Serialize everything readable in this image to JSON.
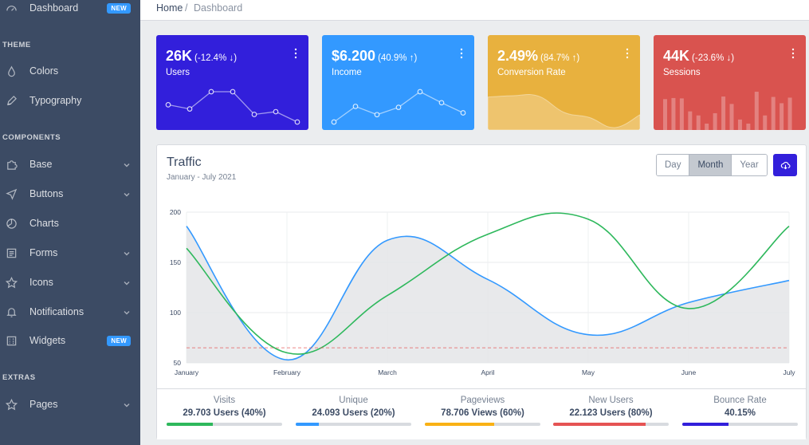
{
  "sidebar": {
    "dashboard": {
      "label": "Dashboard",
      "badge": "NEW",
      "icon": "speedometer-icon"
    },
    "section_theme": "THEME",
    "colors": {
      "label": "Colors",
      "icon": "drop-icon"
    },
    "typography": {
      "label": "Typography",
      "icon": "pencil-icon"
    },
    "section_components": "COMPONENTS",
    "base": {
      "label": "Base",
      "icon": "puzzle-icon"
    },
    "buttons": {
      "label": "Buttons",
      "icon": "cursor-icon"
    },
    "charts": {
      "label": "Charts",
      "icon": "chart-pie-icon"
    },
    "forms": {
      "label": "Forms",
      "icon": "notes-icon"
    },
    "icons": {
      "label": "Icons",
      "icon": "star-icon"
    },
    "notifications": {
      "label": "Notifications",
      "icon": "bell-icon"
    },
    "widgets": {
      "label": "Widgets",
      "badge": "NEW",
      "icon": "calculator-icon"
    },
    "section_extras": "EXTRAS",
    "pages": {
      "label": "Pages",
      "icon": "star-icon"
    }
  },
  "breadcrumb": {
    "home": "Home",
    "separator": "/",
    "current": "Dashboard"
  },
  "widgets": [
    {
      "value": "26K",
      "change": "(-12.4% ↓)",
      "label": "Users",
      "color": "#321fdb",
      "chart": "line-points",
      "points": [
        65,
        59,
        84,
        84,
        51,
        55,
        40
      ]
    },
    {
      "value": "$6.200",
      "change": "(40.9% ↑)",
      "label": "Income",
      "color": "#3399ff",
      "chart": "line-points",
      "points": [
        1,
        18,
        9,
        17,
        34,
        22,
        11
      ]
    },
    {
      "value": "2.49%",
      "change": "(84.7% ↑)",
      "label": "Conversion Rate",
      "color": "#e8b13e",
      "chart": "area",
      "points": [
        78,
        81,
        80,
        45,
        34,
        12,
        40
      ]
    },
    {
      "value": "44K",
      "change": "(-23.6% ↓)",
      "label": "Sessions",
      "color": "#d9534f",
      "chart": "bar",
      "points": [
        78,
        81,
        80,
        45,
        34,
        12,
        40,
        85,
        65,
        23,
        12,
        98,
        34,
        84,
        67,
        82
      ]
    }
  ],
  "traffic": {
    "title": "Traffic",
    "subtitle": "January - July 2021",
    "ranges": [
      "Day",
      "Month",
      "Year"
    ],
    "active_range": "Month",
    "download_icon": "cloud-download-icon"
  },
  "chart_data": {
    "type": "line",
    "categories": [
      "January",
      "February",
      "March",
      "April",
      "May",
      "June",
      "July"
    ],
    "ylim": [
      50,
      200
    ],
    "yticks": [
      50,
      100,
      150,
      200
    ],
    "series": [
      {
        "values": [
          186,
          53,
          172,
          133,
          78,
          110,
          132
        ],
        "color": "#3399ff",
        "fill": "#e4e5e8"
      },
      {
        "values": [
          164,
          60,
          117,
          178,
          193,
          104,
          186
        ],
        "color": "#2eb85c"
      },
      {
        "values": [
          65,
          65,
          65,
          65,
          65,
          65,
          65
        ],
        "color": "#e55353",
        "dashed": true
      }
    ],
    "grid": true
  },
  "stats": [
    {
      "label": "Visits",
      "value": "29.703 Users (40%)",
      "percent": 40,
      "color": "#2eb85c"
    },
    {
      "label": "Unique",
      "value": "24.093 Users (20%)",
      "percent": 20,
      "color": "#39f"
    },
    {
      "label": "Pageviews",
      "value": "78.706 Views (60%)",
      "percent": 60,
      "color": "#f9b115"
    },
    {
      "label": "New Users",
      "value": "22.123 Users (80%)",
      "percent": 80,
      "color": "#e55353"
    },
    {
      "label": "Bounce Rate",
      "value": "40.15%",
      "percent": 40,
      "color": "#321fdb"
    }
  ]
}
